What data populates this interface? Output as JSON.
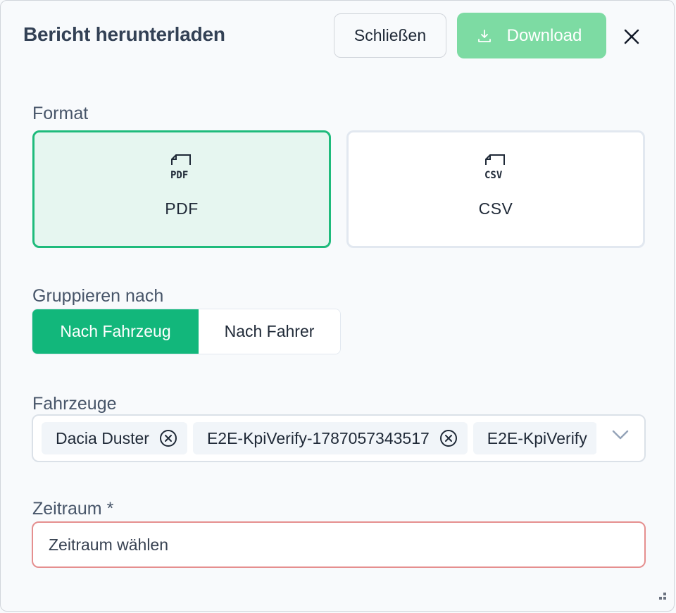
{
  "dialog": {
    "title": "Bericht herunterladen",
    "close_label": "Schließen",
    "download_label": "Download"
  },
  "format": {
    "label": "Format",
    "options": [
      {
        "label": "PDF",
        "icon": "pdf-file-icon",
        "selected": true
      },
      {
        "label": "CSV",
        "icon": "csv-file-icon",
        "selected": false
      }
    ]
  },
  "group": {
    "label": "Gruppieren nach",
    "options": [
      {
        "label": "Nach Fahrzeug",
        "active": true
      },
      {
        "label": "Nach Fahrer",
        "active": false
      }
    ]
  },
  "vehicles": {
    "label": "Fahrzeuge",
    "chips": [
      "Dacia Duster",
      "E2E-KpiVerify-1787057343517",
      "E2E-KpiVerify"
    ]
  },
  "period": {
    "label": "Zeitraum *",
    "value": "Zeitraum wählen"
  },
  "colors": {
    "accent": "#12b77b",
    "download_bg": "#7ddba3",
    "error_border": "#e58f8f"
  }
}
